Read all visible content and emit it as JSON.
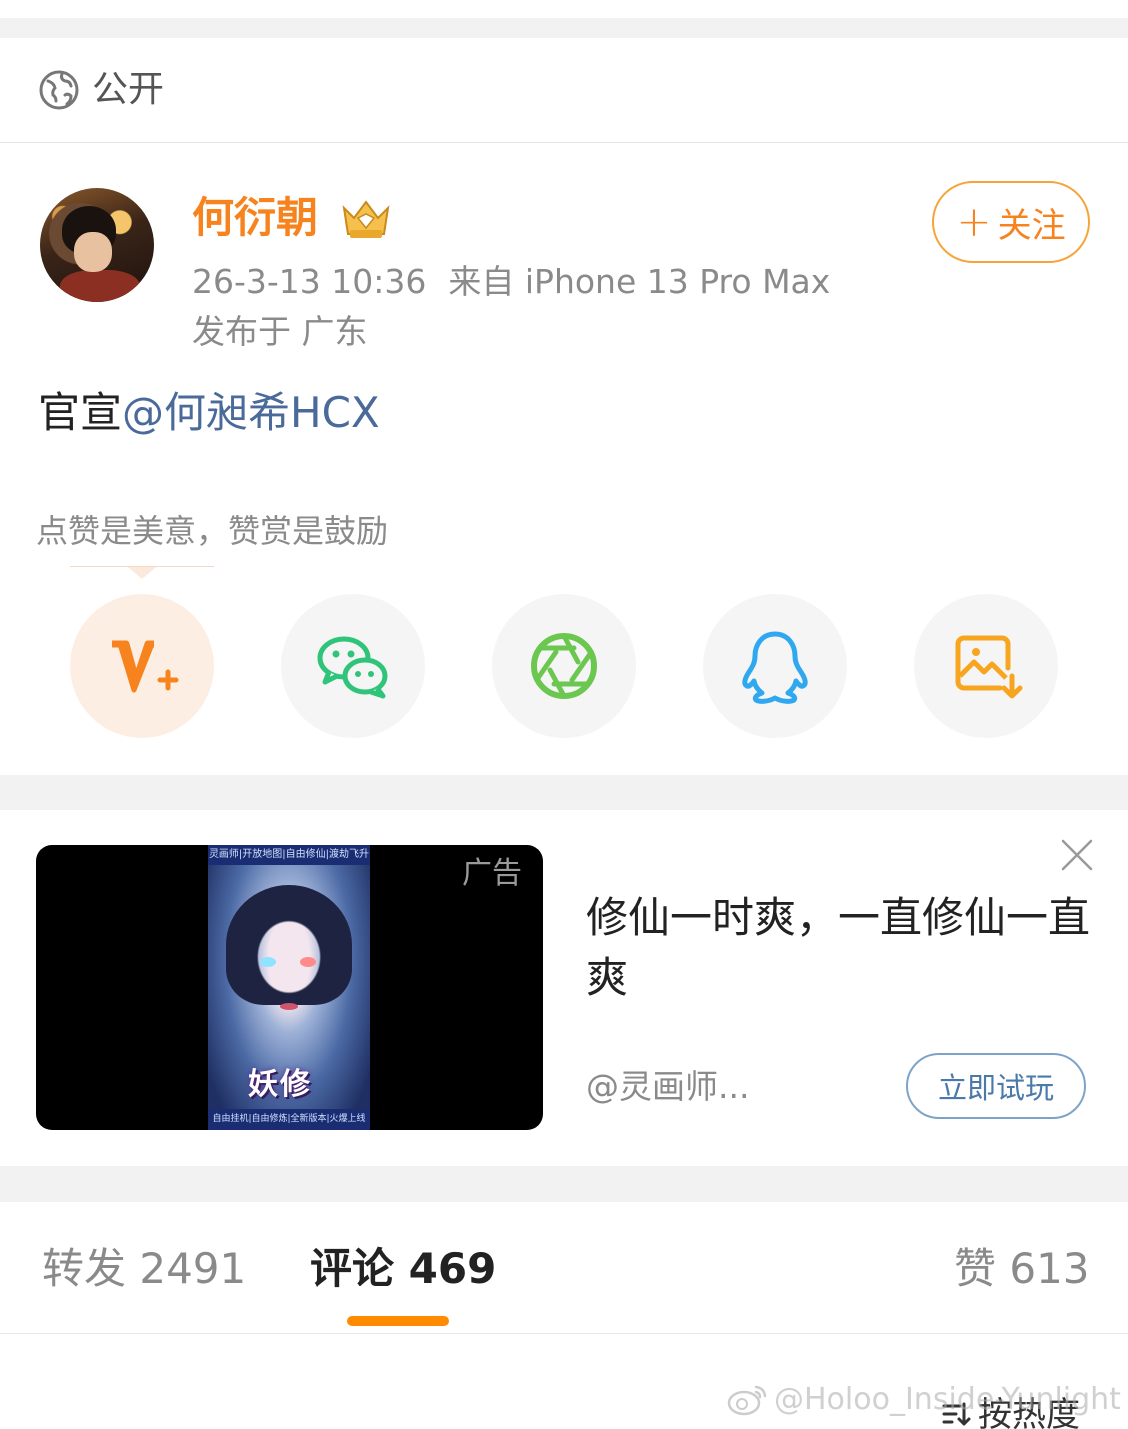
{
  "visibility": {
    "label": "公开",
    "icon": "globe-icon"
  },
  "post": {
    "username": "何衍朝",
    "badge_icon": "crown-badge-icon",
    "timestamp": "26-3-13 10:36",
    "source": "来自 iPhone 13 Pro Max",
    "location": "发布于 广东",
    "follow_label": "关注",
    "text_prefix": "官宣",
    "mention": "@何昶希HCX",
    "reward_hint": "点赞是美意，赞赏是鼓励",
    "share_buttons": [
      {
        "name": "weibo-vplus",
        "icon": "v-plus-icon",
        "color": "#f7831f"
      },
      {
        "name": "wechat",
        "icon": "wechat-icon",
        "color": "#2fc47a"
      },
      {
        "name": "moments",
        "icon": "aperture-icon",
        "color": "#6cc750"
      },
      {
        "name": "qq",
        "icon": "qq-penguin-icon",
        "color": "#30a8f0"
      },
      {
        "name": "save-image",
        "icon": "save-image-icon",
        "color": "#f7a51e"
      }
    ]
  },
  "ad": {
    "badge": "广告",
    "title": "修仙一时爽，一直修仙一直爽",
    "account": "@灵画师...",
    "cta_label": "立即试玩",
    "poster_top": "灵画师|开放地图|自由修仙|渡劫飞升",
    "poster_title": "妖修",
    "poster_bottom": "自由挂机|自由修炼|全新版本|火爆上线"
  },
  "tabs": {
    "repost": "转发 2491",
    "comments": "评论 469",
    "likes": "赞 613"
  },
  "sort": {
    "label": "按热度",
    "icon": "sort-icon"
  },
  "watermark": "@Holoo_Inside-Yunlight",
  "colors": {
    "accent": "#f7831f",
    "mention": "#4a6a9a",
    "tab_indicator": "#ff8c00"
  }
}
